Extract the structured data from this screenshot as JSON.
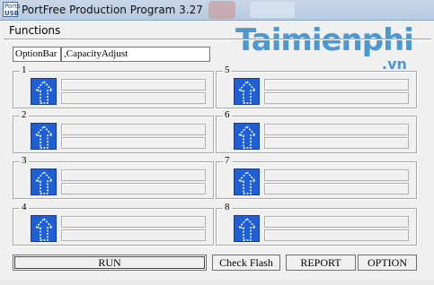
{
  "window": {
    "title": "PortFree Production Program 3.27",
    "icon_text_top": "Ports",
    "icon_text_bottom": "USB"
  },
  "watermark": {
    "main": "Taimienphi",
    "suffix": ".vn"
  },
  "menu": {
    "functions_label": "Functions"
  },
  "option_bar": {
    "label": "OptionBar",
    "value": ",CapacityAdjust"
  },
  "ports": [
    {
      "number": "1"
    },
    {
      "number": "2"
    },
    {
      "number": "3"
    },
    {
      "number": "4"
    },
    {
      "number": "5"
    },
    {
      "number": "6"
    },
    {
      "number": "7"
    },
    {
      "number": "8"
    }
  ],
  "buttons": {
    "run": "RUN",
    "check_flash": "Check Flash",
    "report": "REPORT",
    "option": "OPTION"
  },
  "colors": {
    "port_button": "#1e5fd6",
    "watermark": "#3a8fd0"
  }
}
